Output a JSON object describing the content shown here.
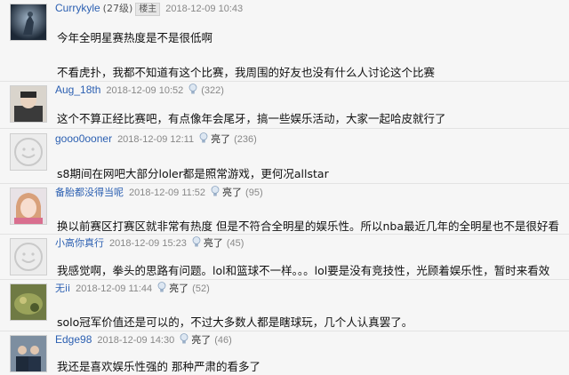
{
  "posts": [
    {
      "username": "Currykyle",
      "level": "(27级)",
      "badge": "楼主",
      "time": "2018-12-09 10:43",
      "lines": [
        "今年全明星赛热度是不是很低啊",
        "",
        "不看虎扑，我都不知道有这个比赛，我周围的好友也没有什么人讨论这个比赛"
      ]
    },
    {
      "username": "Aug_18th",
      "time": "2018-12-09 10:52",
      "like_count": "(322)",
      "lines": [
        "这个不算正经比赛吧，有点像年会尾牙，搞一些娱乐活动，大家一起哈皮就行了"
      ]
    },
    {
      "username": "gooo0ooner",
      "time": "2018-12-09 12:11",
      "like_label": "亮了",
      "like_count": "(236)",
      "lines": [
        "s8期间在网吧大部分loler都是照常游戏，更何况allstar"
      ]
    },
    {
      "username": "备胎都没得当呢",
      "time": "2018-12-09 11:52",
      "like_label": "亮了",
      "like_count": "(95)",
      "lines": [
        "换以前赛区打赛区就非常有热度 但是不符合全明星的娱乐性。所以nba最近几年的全明星也不是很好看"
      ]
    },
    {
      "username": "小高你真行",
      "time": "2018-12-09 15:23",
      "like_label": "亮了",
      "like_count": "(45)",
      "lines": [
        "我感觉啊，拳头的思路有问题。lol和篮球不一样。。。lol要是没有竞技性，光顾着娱乐性，暂时来看效"
      ]
    },
    {
      "username": "无ii",
      "time": "2018-12-09 11:44",
      "like_label": "亮了",
      "like_count": "(52)",
      "lines": [
        "solo冠军价值还是可以的，不过大多数人都是瞎球玩，几个人认真罢了。"
      ]
    },
    {
      "username": "Edge98",
      "time": "2018-12-09 14:30",
      "like_label": "亮了",
      "like_count": "(46)",
      "lines": [
        "我还是喜欢娱乐性强的 那种严肃的看多了"
      ]
    }
  ]
}
